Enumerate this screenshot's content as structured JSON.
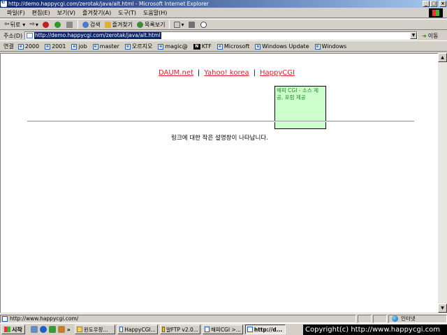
{
  "window": {
    "title": "http://demo.happycgi.com/zerotak/java/alt.html - Microsoft Internet Explorer",
    "min": "_",
    "max": "□",
    "close": "×"
  },
  "menu": [
    "파일(F)",
    "편집(E)",
    "보기(V)",
    "즐겨찾기(A)",
    "도구(T)",
    "도움말(H)"
  ],
  "toolbar": {
    "back": "뒤로",
    "search": "검색",
    "favorites": "즐겨찾기",
    "history": "목록보기"
  },
  "address": {
    "label": "주소(D)",
    "url": "http://demo.happycgi.com/zerotak/java/alt.html",
    "go": "이동"
  },
  "links": {
    "label": "연결",
    "items": [
      "2000",
      "2001",
      "job",
      "master",
      "오르지오",
      "magic@",
      "KTF",
      "Microsoft",
      "Windows Update",
      "Windows"
    ]
  },
  "page": {
    "link1": "DAUM.net",
    "link2": "Yahoo! korea",
    "link3": "HappyCGI",
    "separator": "|",
    "tooltip_accent": "해피 CGI - 소스 제",
    "tooltip_rest": "공, 포럼 제공",
    "description": "링크에 대한 작은 설명창이 나타납니다."
  },
  "status": {
    "url": "http://www.happycgi.com/",
    "zone": "인터넷"
  },
  "taskbar": {
    "start": "시작",
    "tasks": [
      "윈도우창...",
      "HappyCGI...",
      "알FTP v2.0...",
      "해피CGI >...",
      "http://d..."
    ],
    "copyright": "Copyright(c) http://www.happycgi.com"
  }
}
